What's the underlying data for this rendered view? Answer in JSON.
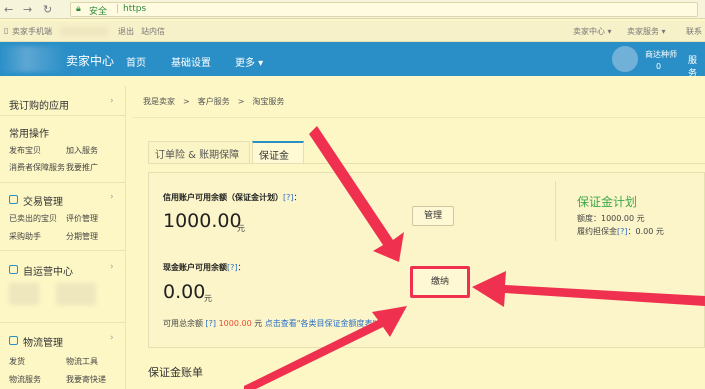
{
  "browser": {
    "back_icon": "back-arrow-icon",
    "forward_icon": "forward-arrow-icon",
    "reload_icon": "reload-icon",
    "secure_label": "安全",
    "url_text": "https"
  },
  "topstrip": {
    "phone_label": "卖家手机端",
    "logout": "退出",
    "inbox": "站内信",
    "seller_center": "卖家中心 ▾",
    "seller_service": "卖家服务 ▾",
    "contact": "联系"
  },
  "header": {
    "brand": "卖家中心",
    "nav": [
      "首页",
      "基础设置",
      "更多 ▾"
    ],
    "user_name": "商达种师",
    "user_count": "0",
    "more_short": "服务"
  },
  "sidebar": {
    "my_apps": "我订购的应用",
    "common": "常用操作",
    "common_links": [
      "发布宝贝",
      "加入服务",
      "消费者保障服务",
      "我要推广"
    ],
    "trade": "交易管理",
    "trade_links": [
      "已卖出的宝贝",
      "评价管理",
      "采购助手",
      "分期管理"
    ],
    "self": "自运营中心",
    "logistics": "物流管理",
    "logistics_links": [
      "发货",
      "物流工具",
      "物流服务",
      "我要寄快递"
    ]
  },
  "breadcrumb": [
    "我是卖家",
    ">",
    "客户服务",
    ">",
    "淘宝服务"
  ],
  "tabs": [
    "订单险 & 账期保障",
    "保证金"
  ],
  "credit": {
    "label": "信用账户可用余额（保证金计划）",
    "help": "[?]",
    "colon": "：",
    "amount": "1000.00",
    "unit": "元",
    "manage_button": "管理"
  },
  "cash": {
    "label": "现金账户可用余额",
    "help": "[?]",
    "colon": "：",
    "amount": "0.00",
    "unit": "元",
    "pay_button": "缴纳"
  },
  "guarantee_plan": {
    "title": "保证金计划",
    "quota": "额度：1000.00 元",
    "bond_label": "履约担保金",
    "bond_help": "[?]",
    "bond_value": "：0.00 元"
  },
  "available_total": {
    "label": "可用总余额",
    "help": "[?]",
    "amount": "1000.00",
    "unit": "元",
    "link": "点击查看\"各类目保证金额度表\""
  },
  "ledger_title": "保证金账单",
  "annotation": {
    "arrow_color": "#f0304f"
  }
}
